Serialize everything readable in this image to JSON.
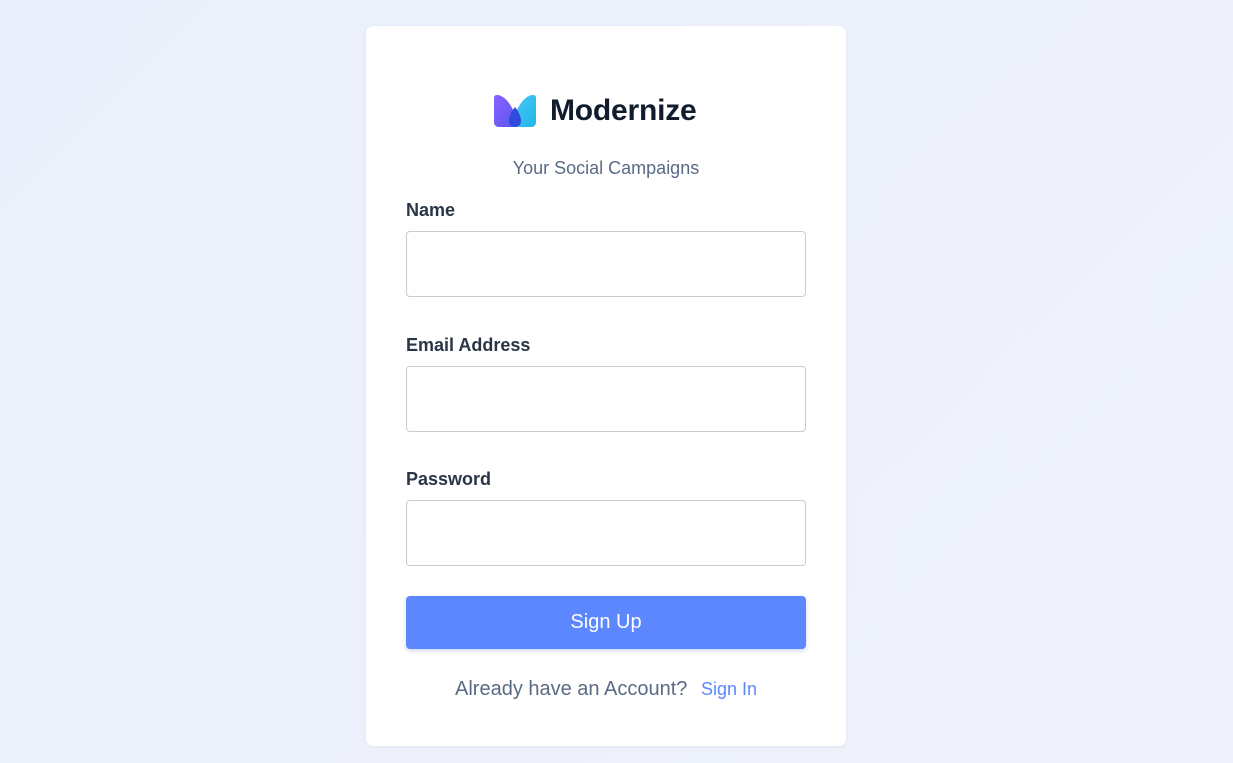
{
  "brand": {
    "name": "Modernize",
    "tagline": "Your Social Campaigns",
    "logo_icon": "modernize-logo-icon"
  },
  "form": {
    "name_label": "Name",
    "name_value": "",
    "email_label": "Email Address",
    "email_value": "",
    "password_label": "Password",
    "password_value": "",
    "submit_label": "Sign Up"
  },
  "footer": {
    "prompt": "Already have an Account?",
    "link_label": "Sign In"
  },
  "colors": {
    "primary": "#5d87ff",
    "text_dark": "#2a3547",
    "text_muted": "#5a6a85",
    "background": "#ecf1fb"
  }
}
